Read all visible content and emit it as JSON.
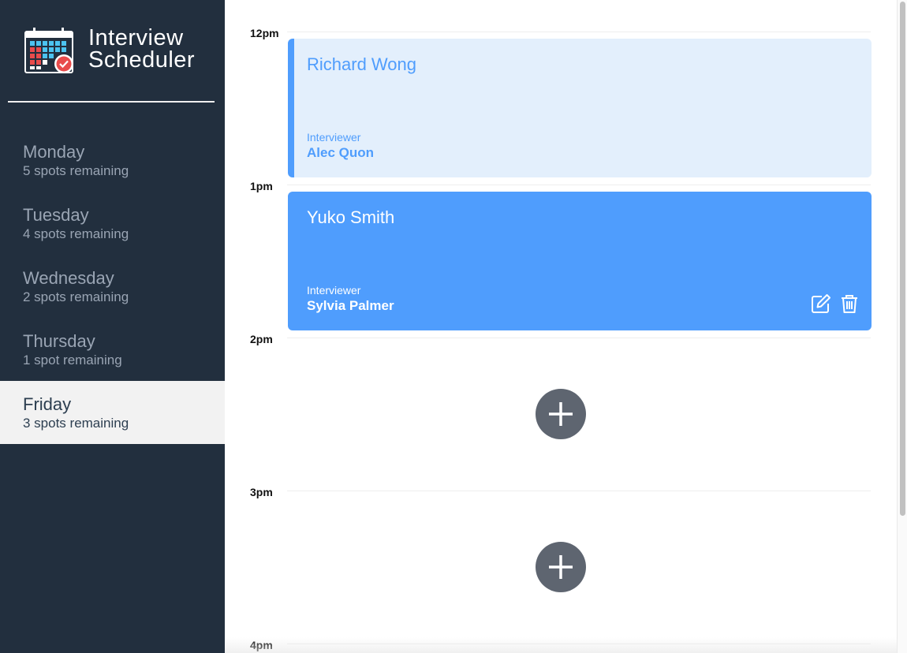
{
  "brand": {
    "line1": "Interview",
    "line2": "Scheduler"
  },
  "days": [
    {
      "name": "Monday",
      "spots": "5 spots remaining",
      "selected": false
    },
    {
      "name": "Tuesday",
      "spots": "4 spots remaining",
      "selected": false
    },
    {
      "name": "Wednesday",
      "spots": "2 spots remaining",
      "selected": false
    },
    {
      "name": "Thursday",
      "spots": "1 spot remaining",
      "selected": false
    },
    {
      "name": "Friday",
      "spots": "3 spots remaining",
      "selected": true
    }
  ],
  "slots": [
    {
      "time": "12pm",
      "student": "Richard Wong",
      "interviewer_label": "Interviewer",
      "interviewer": "Alec Quon"
    },
    {
      "time": "1pm",
      "student": "Yuko Smith",
      "interviewer_label": "Interviewer",
      "interviewer": "Sylvia Palmer"
    },
    {
      "time": "2pm"
    },
    {
      "time": "3pm"
    },
    {
      "time": "4pm"
    }
  ],
  "icons": {
    "logo": "calendar-check-icon",
    "edit": "edit-icon",
    "delete": "trash-icon",
    "add": "plus-icon"
  },
  "colors": {
    "sidebar_bg": "#222f3e",
    "accent": "#4f9dfd",
    "accent_light": "#e3effc",
    "add_button": "#5e6570"
  }
}
